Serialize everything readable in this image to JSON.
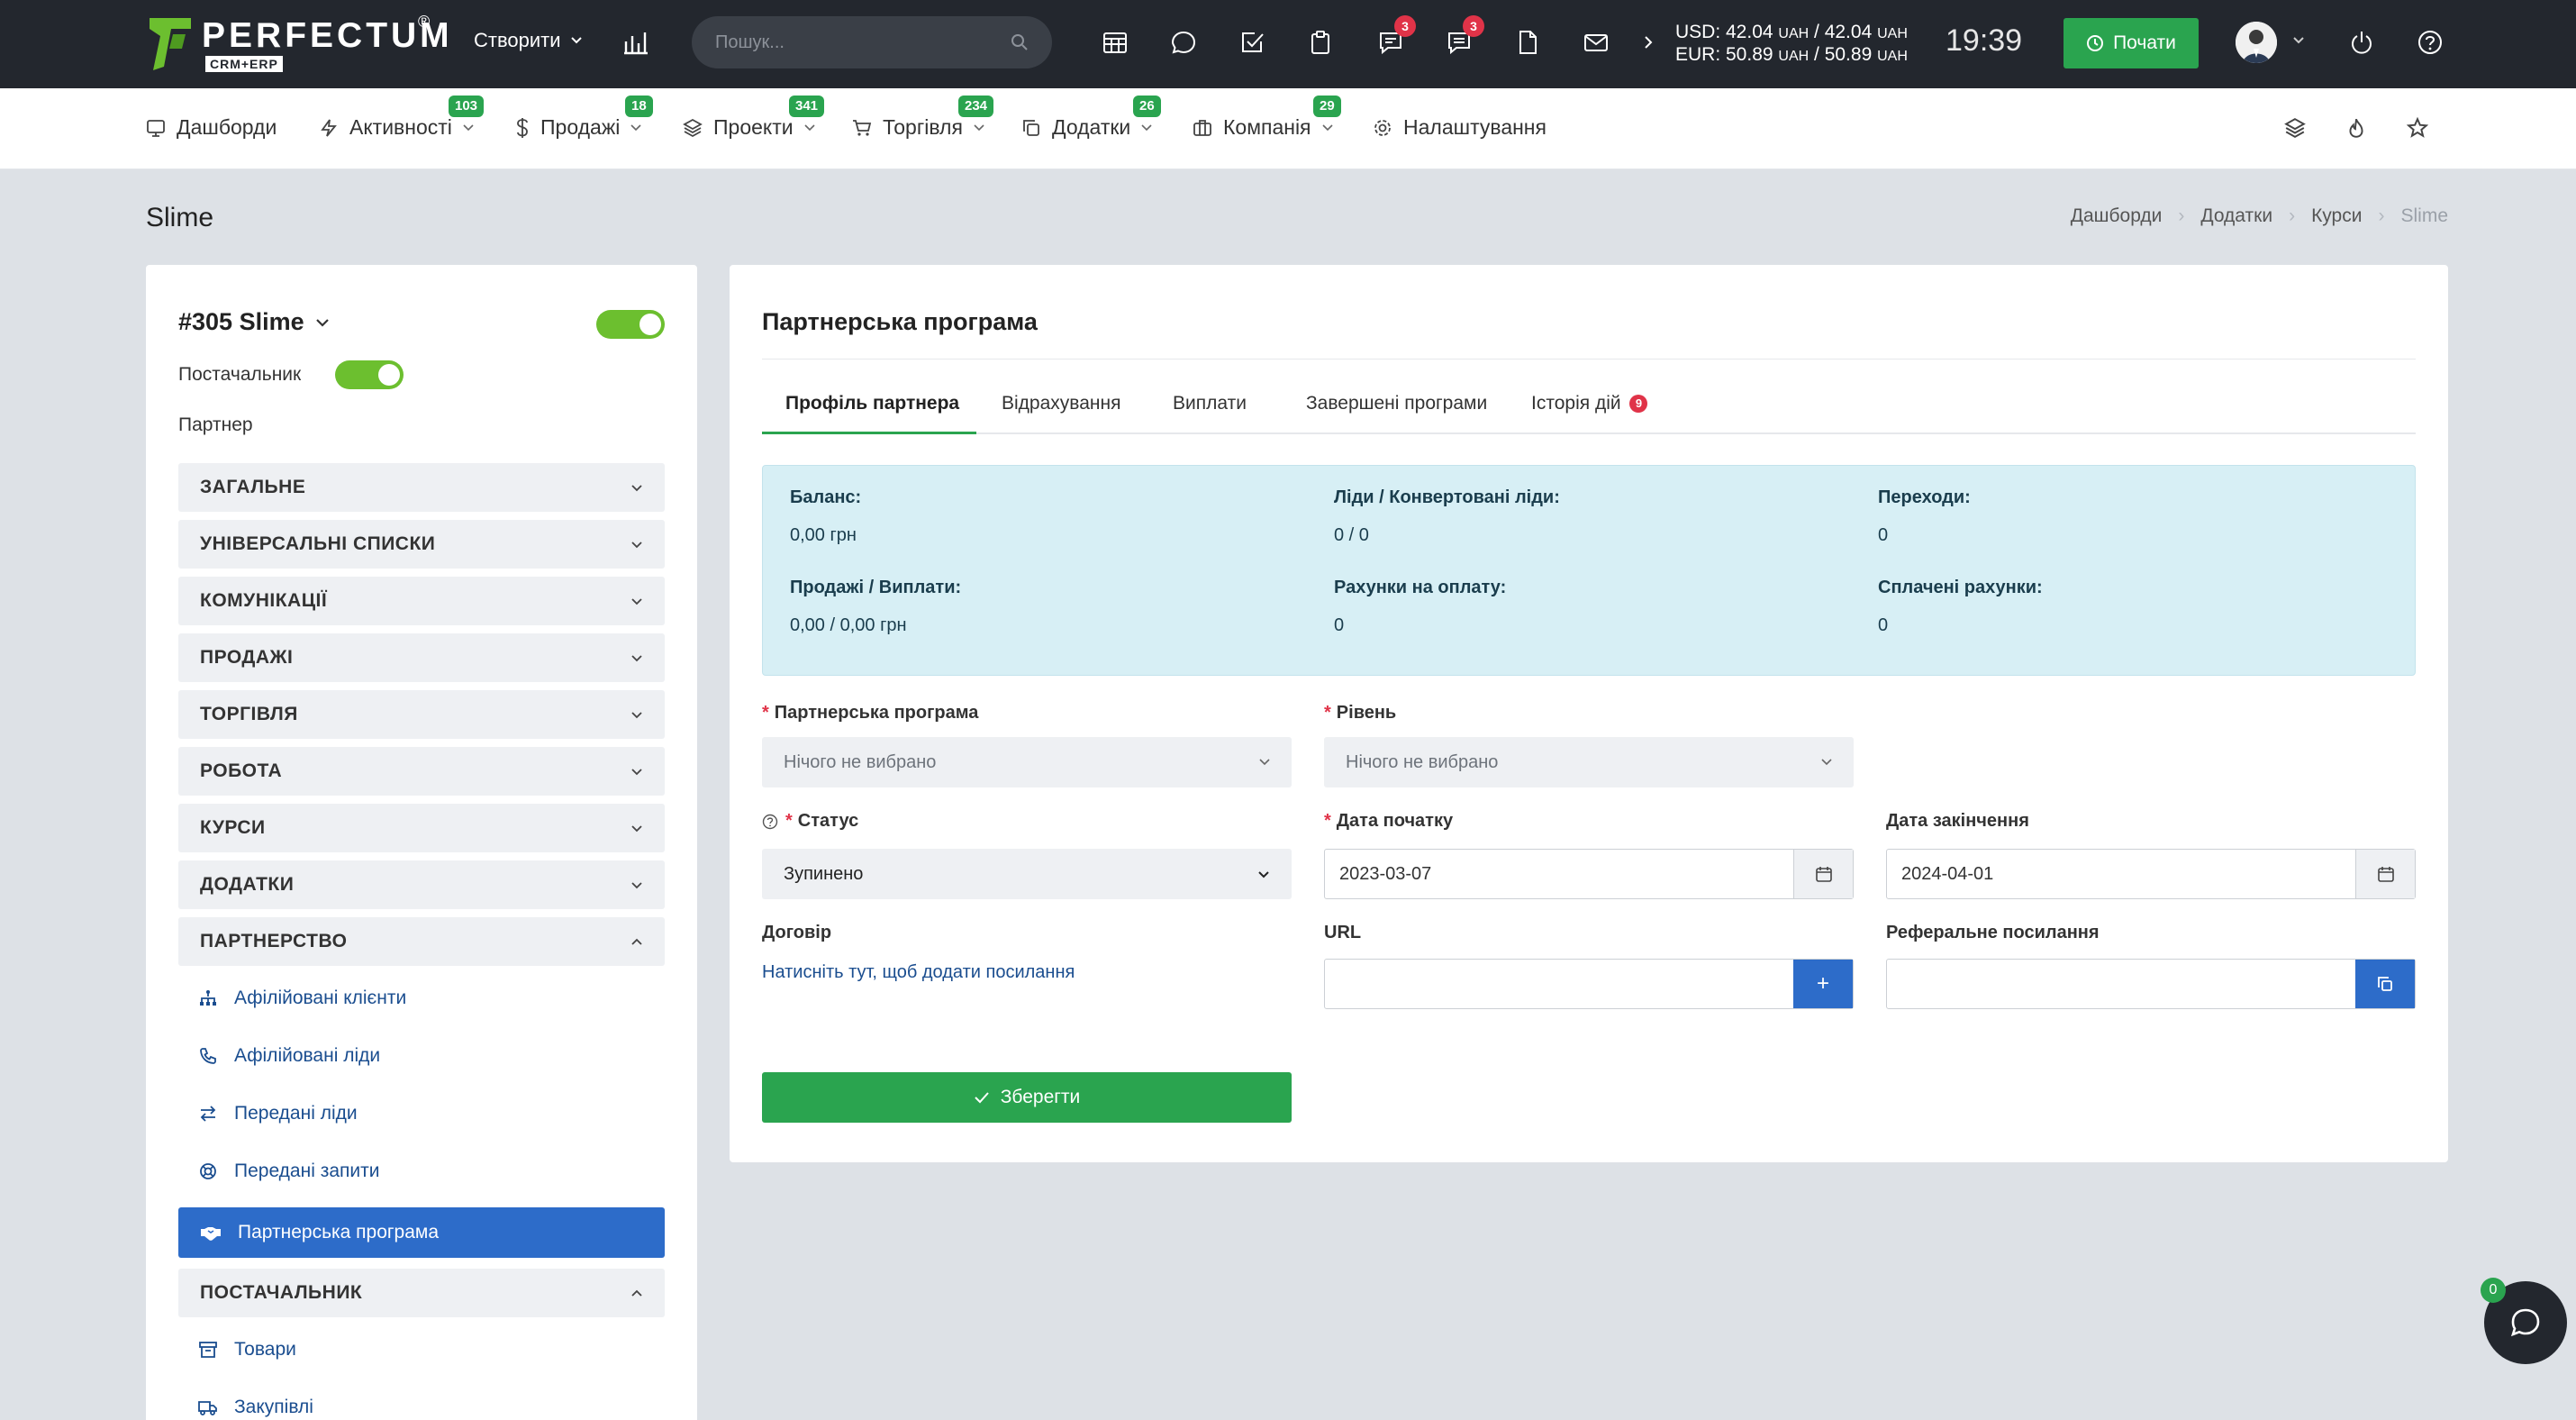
{
  "header": {
    "logo_text": "PERFECTUM",
    "logo_sub": "CRM+ERP",
    "logo_reg": "®",
    "create_label": "Створити",
    "search_placeholder": "Пошук...",
    "badges": {
      "announcements": "3",
      "messages": "3"
    },
    "rates": {
      "usd_label": "USD: 42.04",
      "usd_unit1": "UAH",
      "usd_sep": " / 42.04",
      "usd_unit2": "UAH",
      "eur_label": "EUR: 50.89",
      "eur_unit1": "UAH",
      "eur_sep": " / 50.89",
      "eur_unit2": "UAH"
    },
    "clock": "19:39",
    "start_label": "Почати"
  },
  "nav": {
    "items": [
      {
        "label": "Дашборди",
        "badge": ""
      },
      {
        "label": "Активності",
        "badge": "103"
      },
      {
        "label": "Продажі",
        "badge": "18"
      },
      {
        "label": "Проекти",
        "badge": "341"
      },
      {
        "label": "Торгівля",
        "badge": "234"
      },
      {
        "label": "Додатки",
        "badge": "26"
      },
      {
        "label": "Компанія",
        "badge": "29"
      },
      {
        "label": "Налаштування",
        "badge": ""
      }
    ]
  },
  "page": {
    "title": "Slime",
    "breadcrumbs": [
      "Дашборди",
      "Додатки",
      "Курси",
      "Slime"
    ]
  },
  "sidebar": {
    "record_title": "#305 Slime",
    "supplier_label": "Постачальник",
    "partner_label": "Партнер",
    "sections": [
      "ЗАГАЛЬНЕ",
      "УНІВЕРСАЛЬНІ СПИСКИ",
      "КОМУНІКАЦІЇ",
      "ПРОДАЖІ",
      "ТОРГІВЛЯ",
      "РОБОТА",
      "КУРСИ",
      "ДОДАТКИ",
      "ПАРТНЕРСТВО"
    ],
    "partner_items": [
      "Афілійовані клієнти",
      "Афілійовані ліди",
      "Передані ліди",
      "Передані запити"
    ],
    "active_item": "Партнерська програма",
    "supplier_section": "ПОСТАЧАЛЬНИК",
    "supplier_items": [
      "Товари",
      "Закупівлі"
    ]
  },
  "main": {
    "title": "Партнерська програма",
    "tabs": [
      "Профіль партнера",
      "Відрахування",
      "Виплати",
      "Завершені програми",
      "Історія дій"
    ],
    "history_badge": "9",
    "info": {
      "balance_label": "Баланс:",
      "balance_value": "0,00 грн",
      "leads_label": "Ліди / Конвертовані ліди:",
      "leads_value": "0 / 0",
      "clicks_label": "Переходи:",
      "clicks_value": "0",
      "sales_label": "Продажі / Виплати:",
      "sales_value": "0,00 / 0,00 грн",
      "invoices_label": "Рахунки на оплату:",
      "invoices_value": "0",
      "paid_label": "Сплачені рахунки:",
      "paid_value": "0"
    },
    "form": {
      "program_label": "Партнерська програма",
      "program_value": "Нічого не вибрано",
      "level_label": "Рівень",
      "level_value": "Нічого не вибрано",
      "status_label": "Статус",
      "status_value": "Зупинено",
      "start_label": "Дата початку",
      "start_value": "2023-03-07",
      "end_label": "Дата закінчення",
      "end_value": "2024-04-01",
      "contract_label": "Договір",
      "contract_link": "Натисніть тут, щоб додати посилання",
      "url_label": "URL",
      "url_value": "",
      "ref_label": "Реферальне посилання",
      "ref_value": "",
      "add_label": "+",
      "save_label": "Зберегти"
    }
  },
  "chat": {
    "badge": "0"
  },
  "colors": {
    "accent_green": "#2aa44f",
    "active_blue": "#2d6cc9",
    "topbar": "#23272e"
  }
}
